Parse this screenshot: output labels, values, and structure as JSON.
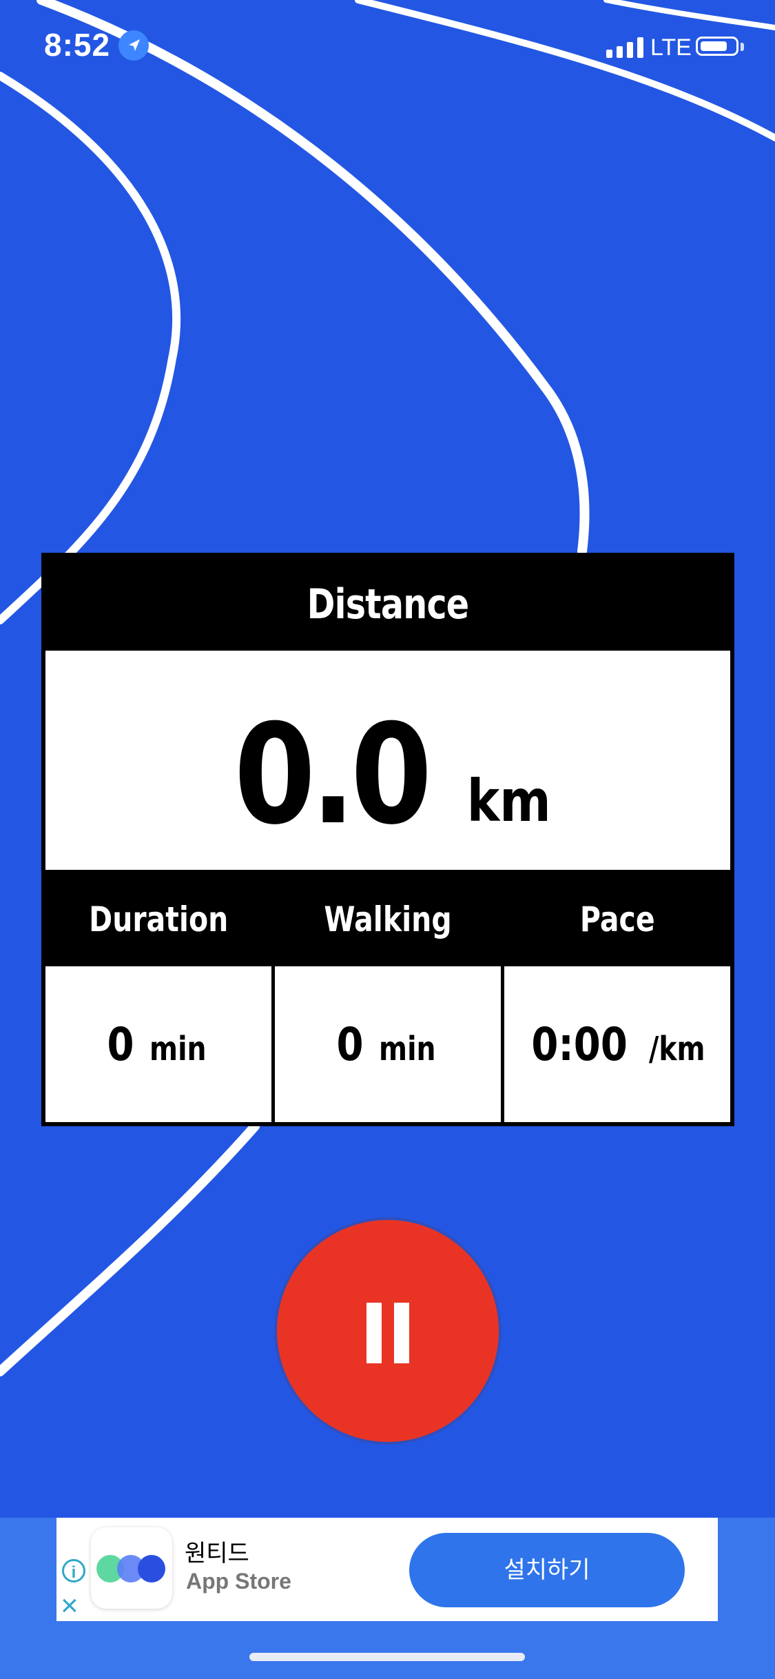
{
  "status_bar": {
    "time": "8:52",
    "network": "LTE"
  },
  "stats": {
    "distance_label": "Distance",
    "distance_value": "0.0",
    "distance_unit": "km",
    "duration_label": "Duration",
    "duration_value": "0",
    "duration_unit": "min",
    "walking_label": "Walking",
    "walking_value": "0",
    "walking_unit": "min",
    "pace_label": "Pace",
    "pace_value": "0:00",
    "pace_unit": "/km"
  },
  "controls": {
    "pause_icon": "pause-icon"
  },
  "ad": {
    "app_name": "원티드",
    "store": "App Store",
    "install_label": "설치하기",
    "info_icon": "info-icon",
    "close_icon": "close-icon"
  },
  "colors": {
    "background": "#2357e3",
    "pause_button": "#e93425",
    "install_button": "#2f74ea"
  }
}
